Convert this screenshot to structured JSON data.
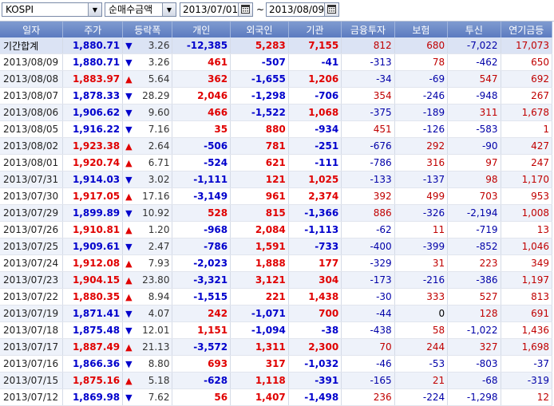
{
  "toolbar": {
    "market": "KOSPI",
    "metric": "순매수금액",
    "start_date": "2013/07/01",
    "end_date": "2013/08/09",
    "separator": "~"
  },
  "columns": [
    "일자",
    "주가",
    "등락폭",
    "개인",
    "외국인",
    "기관",
    "금융투자",
    "보험",
    "투신",
    "연기금등"
  ],
  "rows": [
    {
      "date": "기간합계",
      "price": "1,880.71",
      "dir": "dn",
      "chg": "3.26",
      "ind": "-12,385",
      "frn": "5,283",
      "inst": "7,155",
      "fin": "812",
      "ins": "680",
      "trust": "-7,022",
      "pension": "17,073"
    },
    {
      "date": "2013/08/09",
      "price": "1,880.71",
      "dir": "dn",
      "chg": "3.26",
      "ind": "461",
      "frn": "-507",
      "inst": "-41",
      "fin": "-313",
      "ins": "78",
      "trust": "-462",
      "pension": "650"
    },
    {
      "date": "2013/08/08",
      "price": "1,883.97",
      "dir": "up",
      "chg": "5.64",
      "ind": "362",
      "frn": "-1,655",
      "inst": "1,206",
      "fin": "-34",
      "ins": "-69",
      "trust": "547",
      "pension": "692"
    },
    {
      "date": "2013/08/07",
      "price": "1,878.33",
      "dir": "dn",
      "chg": "28.29",
      "ind": "2,046",
      "frn": "-1,298",
      "inst": "-706",
      "fin": "354",
      "ins": "-246",
      "trust": "-948",
      "pension": "267"
    },
    {
      "date": "2013/08/06",
      "price": "1,906.62",
      "dir": "dn",
      "chg": "9.60",
      "ind": "466",
      "frn": "-1,522",
      "inst": "1,068",
      "fin": "-375",
      "ins": "-189",
      "trust": "311",
      "pension": "1,678"
    },
    {
      "date": "2013/08/05",
      "price": "1,916.22",
      "dir": "dn",
      "chg": "7.16",
      "ind": "35",
      "frn": "880",
      "inst": "-934",
      "fin": "451",
      "ins": "-126",
      "trust": "-583",
      "pension": "1"
    },
    {
      "date": "2013/08/02",
      "price": "1,923.38",
      "dir": "up",
      "chg": "2.64",
      "ind": "-506",
      "frn": "781",
      "inst": "-251",
      "fin": "-676",
      "ins": "292",
      "trust": "-90",
      "pension": "427"
    },
    {
      "date": "2013/08/01",
      "price": "1,920.74",
      "dir": "up",
      "chg": "6.71",
      "ind": "-524",
      "frn": "621",
      "inst": "-111",
      "fin": "-786",
      "ins": "316",
      "trust": "97",
      "pension": "247"
    },
    {
      "date": "2013/07/31",
      "price": "1,914.03",
      "dir": "dn",
      "chg": "3.02",
      "ind": "-1,111",
      "frn": "121",
      "inst": "1,025",
      "fin": "-133",
      "ins": "-137",
      "trust": "98",
      "pension": "1,170"
    },
    {
      "date": "2013/07/30",
      "price": "1,917.05",
      "dir": "up",
      "chg": "17.16",
      "ind": "-3,149",
      "frn": "961",
      "inst": "2,374",
      "fin": "392",
      "ins": "499",
      "trust": "703",
      "pension": "953"
    },
    {
      "date": "2013/07/29",
      "price": "1,899.89",
      "dir": "dn",
      "chg": "10.92",
      "ind": "528",
      "frn": "815",
      "inst": "-1,366",
      "fin": "886",
      "ins": "-326",
      "trust": "-2,194",
      "pension": "1,008"
    },
    {
      "date": "2013/07/26",
      "price": "1,910.81",
      "dir": "up",
      "chg": "1.20",
      "ind": "-968",
      "frn": "2,084",
      "inst": "-1,113",
      "fin": "-62",
      "ins": "11",
      "trust": "-719",
      "pension": "13"
    },
    {
      "date": "2013/07/25",
      "price": "1,909.61",
      "dir": "dn",
      "chg": "2.47",
      "ind": "-786",
      "frn": "1,591",
      "inst": "-733",
      "fin": "-400",
      "ins": "-399",
      "trust": "-852",
      "pension": "1,046"
    },
    {
      "date": "2013/07/24",
      "price": "1,912.08",
      "dir": "up",
      "chg": "7.93",
      "ind": "-2,023",
      "frn": "1,888",
      "inst": "177",
      "fin": "-329",
      "ins": "31",
      "trust": "223",
      "pension": "349"
    },
    {
      "date": "2013/07/23",
      "price": "1,904.15",
      "dir": "up",
      "chg": "23.80",
      "ind": "-3,321",
      "frn": "3,121",
      "inst": "304",
      "fin": "-173",
      "ins": "-216",
      "trust": "-386",
      "pension": "1,197"
    },
    {
      "date": "2013/07/22",
      "price": "1,880.35",
      "dir": "up",
      "chg": "8.94",
      "ind": "-1,515",
      "frn": "221",
      "inst": "1,438",
      "fin": "-30",
      "ins": "333",
      "trust": "527",
      "pension": "813"
    },
    {
      "date": "2013/07/19",
      "price": "1,871.41",
      "dir": "dn",
      "chg": "4.07",
      "ind": "242",
      "frn": "-1,071",
      "inst": "700",
      "fin": "-44",
      "ins": "0",
      "trust": "128",
      "pension": "691"
    },
    {
      "date": "2013/07/18",
      "price": "1,875.48",
      "dir": "dn",
      "chg": "12.01",
      "ind": "1,151",
      "frn": "-1,094",
      "inst": "-38",
      "fin": "-438",
      "ins": "58",
      "trust": "-1,022",
      "pension": "1,436"
    },
    {
      "date": "2013/07/17",
      "price": "1,887.49",
      "dir": "up",
      "chg": "21.13",
      "ind": "-3,572",
      "frn": "1,311",
      "inst": "2,300",
      "fin": "70",
      "ins": "244",
      "trust": "327",
      "pension": "1,698"
    },
    {
      "date": "2013/07/16",
      "price": "1,866.36",
      "dir": "dn",
      "chg": "8.80",
      "ind": "693",
      "frn": "317",
      "inst": "-1,032",
      "fin": "-46",
      "ins": "-53",
      "trust": "-803",
      "pension": "-37"
    },
    {
      "date": "2013/07/15",
      "price": "1,875.16",
      "dir": "up",
      "chg": "5.18",
      "ind": "-628",
      "frn": "1,118",
      "inst": "-391",
      "fin": "-165",
      "ins": "21",
      "trust": "-68",
      "pension": "-319"
    },
    {
      "date": "2013/07/12",
      "price": "1,869.98",
      "dir": "dn",
      "chg": "7.62",
      "ind": "56",
      "frn": "1,407",
      "inst": "-1,498",
      "fin": "236",
      "ins": "-224",
      "trust": "-1,298",
      "pension": "12"
    }
  ],
  "colors": {
    "up": "#e00000",
    "down": "#0000cc",
    "header": "#6a88c8",
    "total_row": "#dbe3f4"
  },
  "icons": {
    "dropdown": "chevron-down-icon",
    "calendar": "calendar-icon",
    "up": "triangle-up-icon",
    "down": "triangle-down-icon"
  }
}
